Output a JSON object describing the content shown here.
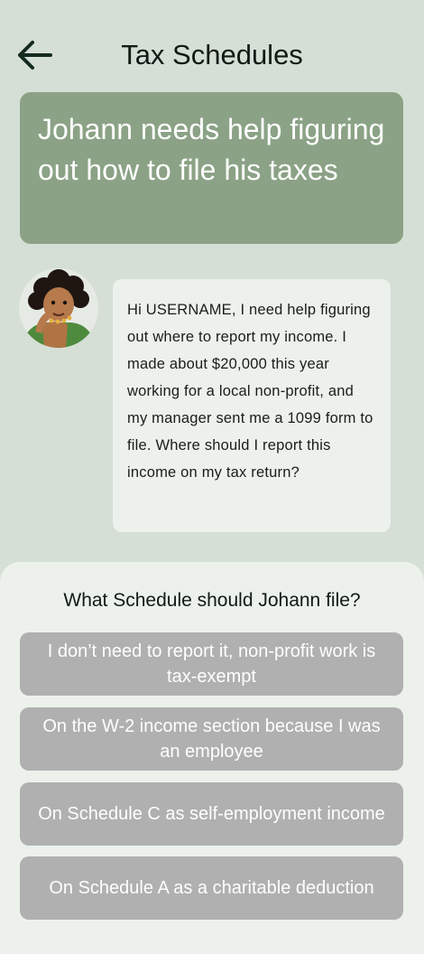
{
  "header": {
    "title": "Tax Schedules",
    "back_icon": "arrow-left-icon"
  },
  "banner": {
    "text": "Johann needs help figuring out how to file his taxes"
  },
  "message": {
    "avatar_icon": "user-avatar",
    "text": "Hi USERNAME, I need help figuring out where to report my income. I made about $20,000 this year working for a local non-profit, and my manager sent me a 1099 form to file. Where should I report this income on my tax return?"
  },
  "quiz": {
    "question": "What Schedule should Johann file?",
    "options": [
      "I don’t need to report it, non-profit work is tax-exempt",
      "On the W-2 income section because I was an employee",
      "On Schedule C as self-employment income",
      "On Schedule A as a charitable deduction"
    ]
  },
  "colors": {
    "background": "#d5dfd5",
    "banner": "#8ba286",
    "bubble": "#ecf1ec",
    "option": "#b0b0b0",
    "text_dark": "#111a14"
  }
}
